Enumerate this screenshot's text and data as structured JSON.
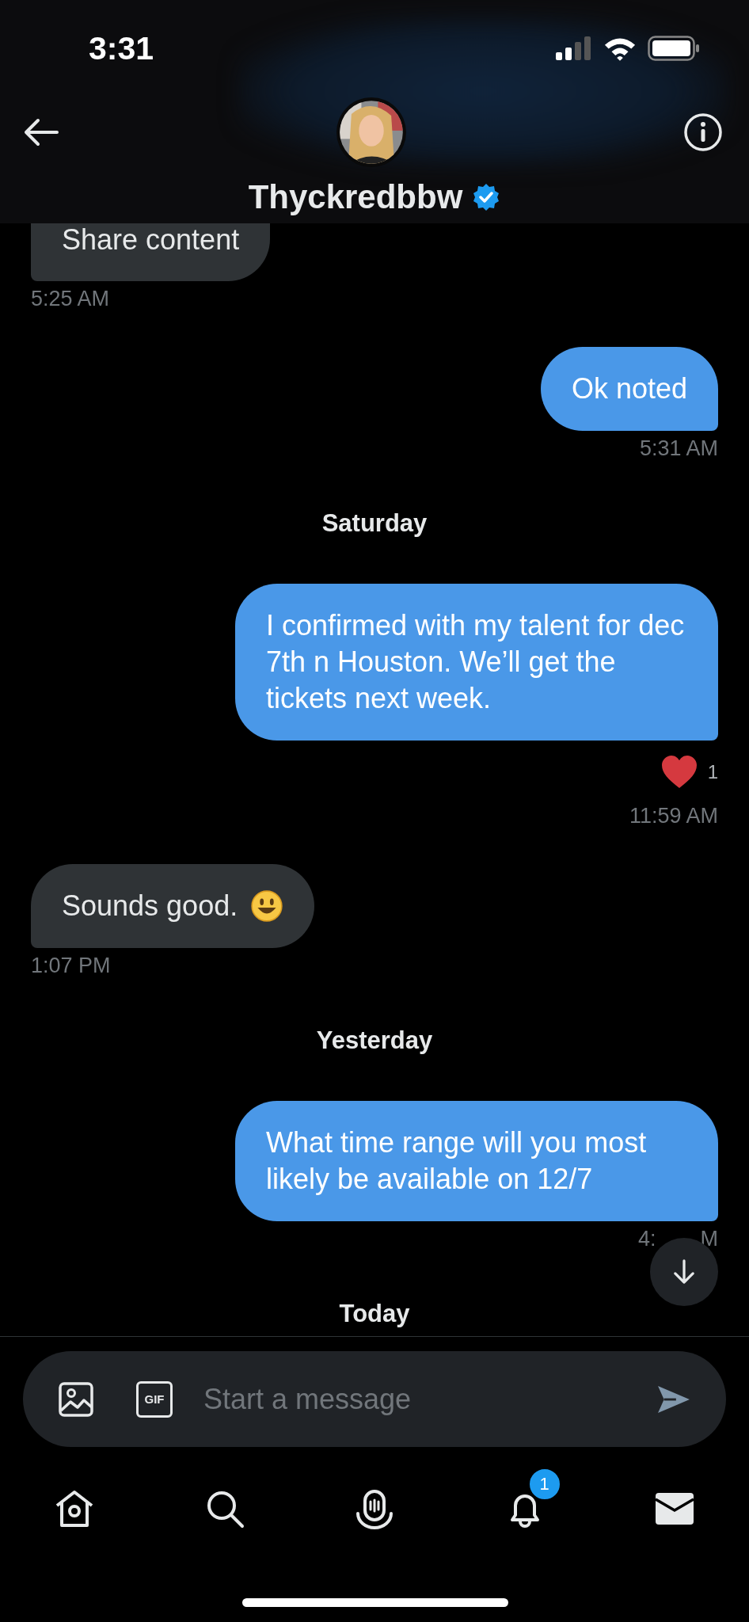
{
  "status_bar": {
    "time": "3:31"
  },
  "header": {
    "name": "Thyckredbbw",
    "verified": true
  },
  "messages": [
    {
      "kind": "received",
      "text": "Share content",
      "time": "5:25 AM"
    },
    {
      "kind": "sent",
      "text": "Ok noted",
      "time": "5:31 AM"
    },
    {
      "kind": "day",
      "text": "Saturday"
    },
    {
      "kind": "sent",
      "text": "I confirmed with my talent for dec 7th n Houston. We’ll get the tickets next week.",
      "reaction": {
        "count": "1"
      },
      "time": "11:59 AM"
    },
    {
      "kind": "received",
      "text": "Sounds good.",
      "emoji": true,
      "time": "1:07 PM"
    },
    {
      "kind": "day",
      "text": "Yesterday"
    },
    {
      "kind": "sent",
      "text": "What time range will you most likely be available on 12/7",
      "time_parts": [
        "4:",
        "M"
      ]
    },
    {
      "kind": "day",
      "text": "Today"
    }
  ],
  "composer": {
    "placeholder": "Start a message",
    "gif_label": "GIF"
  },
  "nav": {
    "notifications_badge": "1"
  }
}
